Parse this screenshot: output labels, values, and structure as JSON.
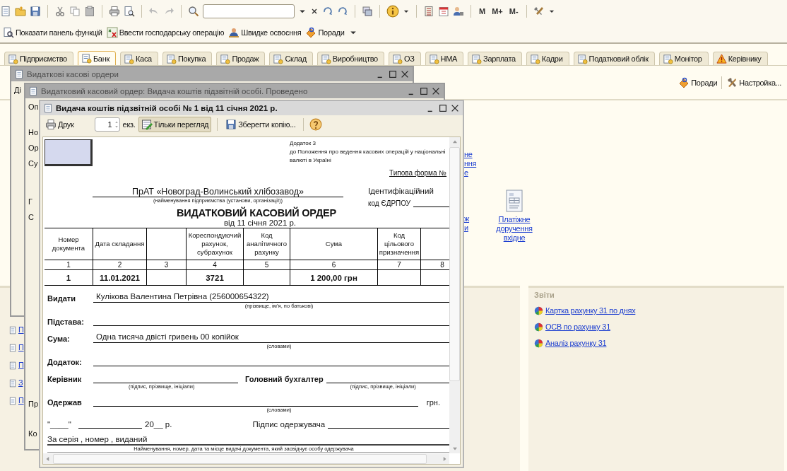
{
  "toolbar": {
    "memory_buttons": [
      "M",
      "M+",
      "M-"
    ]
  },
  "function_panel": {
    "items": [
      "Показати панель функцій",
      "Ввести господарську операцію",
      "Швидке освоєння",
      "Поради"
    ]
  },
  "tabs": [
    {
      "label": "Підприємство",
      "selected": false
    },
    {
      "label": "Банк",
      "selected": true
    },
    {
      "label": "Каса",
      "selected": false
    },
    {
      "label": "Покупка",
      "selected": false
    },
    {
      "label": "Продаж",
      "selected": false
    },
    {
      "label": "Склад",
      "selected": false
    },
    {
      "label": "Виробництво",
      "selected": false
    },
    {
      "label": "ОЗ",
      "selected": false
    },
    {
      "label": "НМА",
      "selected": false
    },
    {
      "label": "Зарплата",
      "selected": false
    },
    {
      "label": "Кадри",
      "selected": false
    },
    {
      "label": "Податковий облік",
      "selected": false
    },
    {
      "label": "Монітор",
      "selected": false
    },
    {
      "label": "Керівнику",
      "selected": false
    }
  ],
  "section_toolbar": [
    "Поради",
    "Настройка..."
  ],
  "main_links": [
    {
      "kind": "fragment",
      "text": "не\nння\nе"
    },
    {
      "kind": "fragment",
      "text": "ж\nи"
    },
    {
      "kind": "icon_link",
      "text": "Платіжне доручення вхідне"
    }
  ],
  "sidebar_links": [
    "П",
    "П",
    "П",
    "З",
    "П"
  ],
  "reports": {
    "title": "Звіти",
    "links": [
      "Картка рахунку 31 по днях",
      "ОСВ по рахунку 31",
      "Аналіз рахунку 31"
    ]
  },
  "windows": [
    {
      "title": "Видаткові касові ордери",
      "active": false,
      "fragments": [
        "Ді"
      ]
    },
    {
      "title": "Видатковий касовий ордер: Видача коштів підзвітній особі. Проведено",
      "active": false,
      "fragments": [
        "Оп",
        "Но",
        "Ор",
        "Су",
        "Г",
        "С"
      ],
      "footer_fragments": [
        "Пр",
        "Ко"
      ]
    }
  ],
  "report_window": {
    "title": "Видача коштів підзвітній особі № 1 від 11 січня 2021 р.",
    "active": true,
    "toolbar": {
      "print": "Друк",
      "copies": "1",
      "copies_unit": "екз.",
      "view_only": {
        "label": "Тільки перегляд",
        "pressed": true
      },
      "save_copy": "Зберегти копію..."
    },
    "document": {
      "appendix": "Додаток 3\nдо Положення про ведення касових операцій у національні\nвалюті в Україні",
      "form_type": "Типова форма  №",
      "organization": "ПрАТ «Новоград-Волинський хлібозавод»",
      "organization_caption": "(найменування підприємства (установи, організації))",
      "id_label": "Ідентифікаційний",
      "edrpou_label": "код ЄДРПОУ",
      "title": "ВИДАТКОВИЙ КАСОВИЙ ОРДЕР",
      "date_line": "від  11 січня 2021 р.",
      "columns": [
        {
          "header": "Номер документа",
          "number": "1",
          "value": "1"
        },
        {
          "header": "Дата складання",
          "number": "2",
          "value": "11.01.2021"
        },
        {
          "number": "3"
        },
        {
          "header": "Кореспондуючий рахунок, субрахунок",
          "number": "4",
          "value": "3721"
        },
        {
          "header": "Код аналітичного рахунку",
          "number": "5"
        },
        {
          "header": "Сума",
          "number": "6",
          "value": "1 200,00 грн"
        },
        {
          "header": "Код цільового призначення",
          "number": "7"
        },
        {
          "number": "8"
        }
      ],
      "rows": [
        {
          "kind": "line",
          "label": "Видати",
          "value": "Кулікова Валентина Петрівна (256000654322)",
          "caption": "(прізвище, ім’я, по батькові)"
        },
        {
          "kind": "line",
          "label": "Підстава:"
        },
        {
          "kind": "line",
          "label": "Сума:",
          "value": "Одна тисяча двісті гривень 00 копійок",
          "caption": "(словами)"
        },
        {
          "kind": "line",
          "label": "Додаток:"
        },
        {
          "kind": "signatures",
          "items": [
            {
              "label": "Керівник",
              "caption": "(підпис, прізвище, ініціали)"
            },
            {
              "label": "Головний бухгалтер",
              "caption": "(підпис, прізвище, ініціали)"
            }
          ]
        },
        {
          "kind": "received",
          "label": "Одержав",
          "suffix": "грн.",
          "caption": "(словами)"
        },
        {
          "kind": "receipt",
          "date_quote": "\"____\"",
          "year": "20__ р.",
          "signature_label": "Підпис одержувача"
        },
        {
          "kind": "id_document",
          "label": "За  серія , номер , виданий",
          "caption": "Найменування, номер, дата та місце видачі документа, який засвідчує особу одержувача"
        }
      ]
    }
  }
}
